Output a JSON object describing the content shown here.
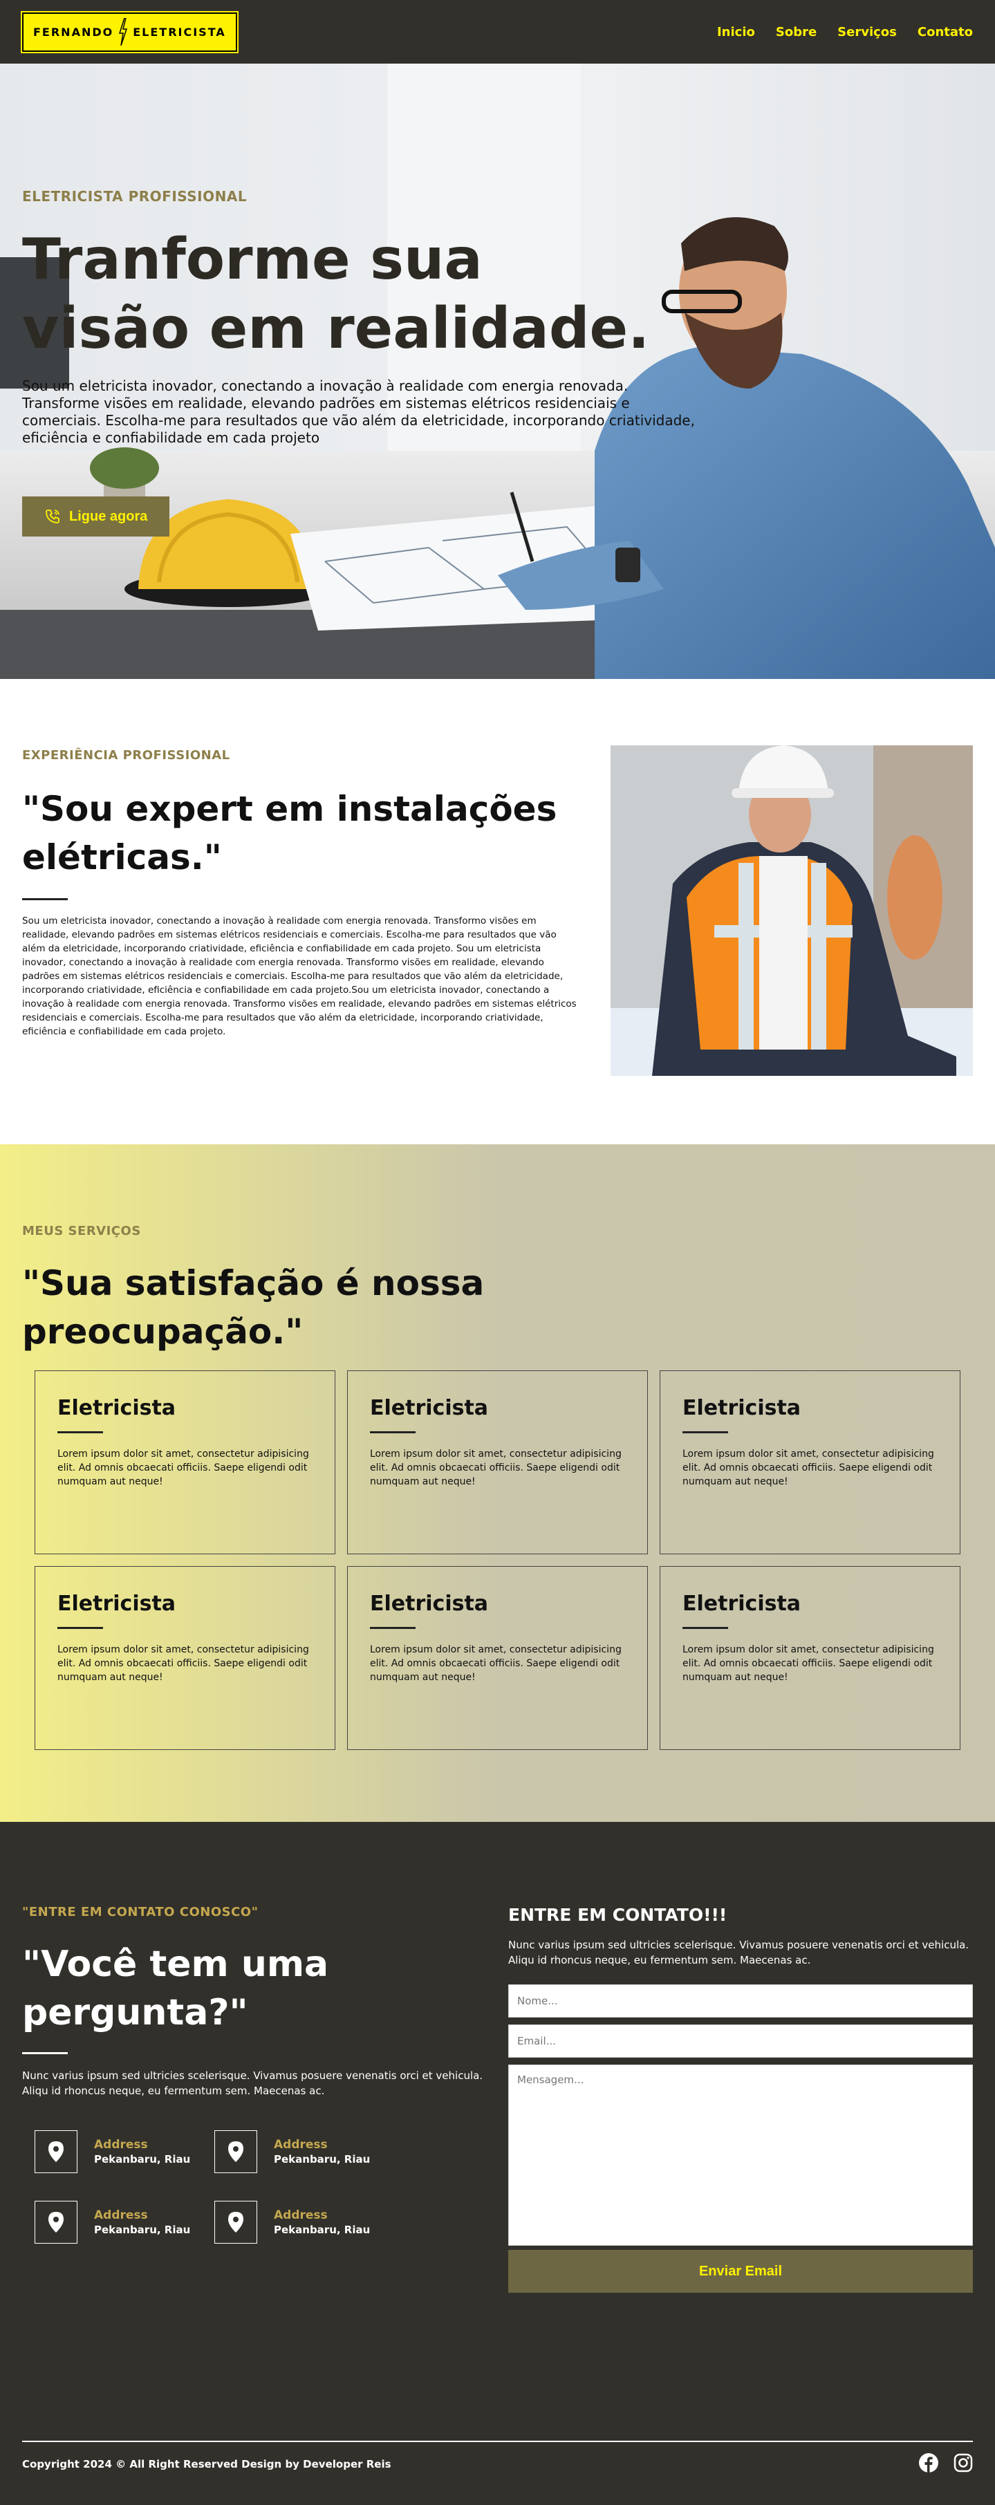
{
  "nav": {
    "logo_left": "FERNANDO",
    "logo_right": "ELETRICISTA",
    "links": [
      "Inicio",
      "Sobre",
      "Serviços",
      "Contato"
    ]
  },
  "hero": {
    "kicker": "ELETRICISTA PROFISSIONAL",
    "title": "Tranforme sua visão em realidade.",
    "text": "Sou um eletricista inovador, conectando a inovação à realidade com energia renovada. Transforme visões em realidade, elevando padrões em sistemas elétricos residenciais e comerciais. Escolha-me para resultados que vão além da eletricidade, incorporando criatividade, eficiência e confiabilidade em cada projeto",
    "cta": "Ligue agora"
  },
  "about": {
    "kicker": "EXPERIÊNCIA PROFISSIONAL",
    "title": "\"Sou expert em instalações elétricas.\"",
    "text": "Sou um eletricista inovador, conectando a inovação à realidade com energia renovada. Transformo visões em realidade, elevando padrões em sistemas elétricos residenciais e comerciais. Escolha-me para resultados que vão além da eletricidade, incorporando criatividade, eficiência e confiabilidade em cada projeto. Sou um eletricista inovador, conectando a inovação à realidade com energia renovada. Transformo visões em realidade, elevando padrões em sistemas elétricos residenciais e comerciais. Escolha-me para resultados que vão além da eletricidade, incorporando criatividade, eficiência e confiabilidade em cada projeto.Sou um eletricista inovador, conectando a inovação à realidade com energia renovada. Transformo visões em realidade, elevando padrões em sistemas elétricos residenciais e comerciais. Escolha-me para resultados que vão além da eletricidade, incorporando criatividade, eficiência e confiabilidade em cada projeto."
  },
  "services": {
    "kicker": "MEUS SERVIÇOS",
    "title": "\"Sua satisfação é nossa preocupação.\"",
    "cards": [
      {
        "title": "Eletricista",
        "text": "Lorem ipsum dolor sit amet, consectetur adipisicing elit. Ad omnis obcaecati officiis. Saepe eligendi odit numquam aut neque!"
      },
      {
        "title": "Eletricista",
        "text": "Lorem ipsum dolor sit amet, consectetur adipisicing elit. Ad omnis obcaecati officiis. Saepe eligendi odit numquam aut neque!"
      },
      {
        "title": "Eletricista",
        "text": "Lorem ipsum dolor sit amet, consectetur adipisicing elit. Ad omnis obcaecati officiis. Saepe eligendi odit numquam aut neque!"
      },
      {
        "title": "Eletricista",
        "text": "Lorem ipsum dolor sit amet, consectetur adipisicing elit. Ad omnis obcaecati officiis. Saepe eligendi odit numquam aut neque!"
      },
      {
        "title": "Eletricista",
        "text": "Lorem ipsum dolor sit amet, consectetur adipisicing elit. Ad omnis obcaecati officiis. Saepe eligendi odit numquam aut neque!"
      },
      {
        "title": "Eletricista",
        "text": "Lorem ipsum dolor sit amet, consectetur adipisicing elit. Ad omnis obcaecati officiis. Saepe eligendi odit numquam aut neque!"
      }
    ]
  },
  "contact": {
    "kicker": "\"ENTRE EM CONTATO CONOSCO\"",
    "title": "\"Você tem uma pergunta?\"",
    "text": "Nunc varius ipsum sed ultricies scelerisque. Vivamus posuere venenatis orci et vehicula. Aliqu id rhoncus neque, eu fermentum sem. Maecenas ac.",
    "addresses": [
      {
        "label": "Address",
        "value": "Pekanbaru, Riau"
      },
      {
        "label": "Address",
        "value": "Pekanbaru, Riau"
      },
      {
        "label": "Address",
        "value": "Pekanbaru, Riau"
      },
      {
        "label": "Address",
        "value": "Pekanbaru, Riau"
      }
    ],
    "form_title": "ENTRE EM CONTATO!!!",
    "form_text": "Nunc varius ipsum sed ultricies scelerisque. Vivamus posuere venenatis orci et vehicula. Aliqu id rhoncus neque, eu fermentum sem. Maecenas ac.",
    "name_placeholder": "Nome...",
    "email_placeholder": "Email...",
    "message_placeholder": "Mensagem...",
    "submit": "Enviar Email"
  },
  "footer": {
    "copyright": "Copyright 2024 © All Right Reserved Design by Developer Reis",
    "icons": [
      "facebook-icon",
      "instagram-icon"
    ]
  },
  "colors": {
    "dark": "#32302b",
    "accent_yellow": "#fff200",
    "olive": "#7a7140",
    "gold_kicker": "#8d7f4a"
  }
}
